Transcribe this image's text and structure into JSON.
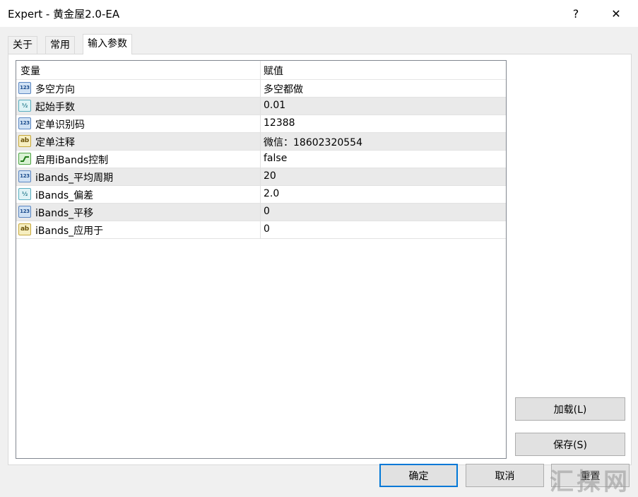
{
  "window": {
    "title": "Expert - 黄金屋2.0-EA",
    "help_glyph": "?",
    "close_glyph": "✕"
  },
  "tabs": [
    {
      "label": "关于"
    },
    {
      "label": "常用"
    },
    {
      "label": "输入参数",
      "active": true
    }
  ],
  "grid": {
    "headers": {
      "variable": "变量",
      "value": "赋值"
    },
    "rows": [
      {
        "icon": "int-icon",
        "type_glyph": "123",
        "name": "多空方向",
        "value": "多空都做"
      },
      {
        "icon": "double-icon",
        "type_glyph": "½",
        "name": "起始手数",
        "value": "0.01"
      },
      {
        "icon": "int-icon",
        "type_glyph": "123",
        "name": "定单识别码",
        "value": "12388"
      },
      {
        "icon": "string-icon",
        "type_glyph": "ab",
        "name": "定单注释",
        "value": "微信：18602320554"
      },
      {
        "icon": "bool-icon",
        "type_glyph": "",
        "name": "启用iBands控制",
        "value": "false"
      },
      {
        "icon": "int-icon",
        "type_glyph": "123",
        "name": "iBands_平均周期",
        "value": "20"
      },
      {
        "icon": "double-icon",
        "type_glyph": "½",
        "name": "iBands_偏差",
        "value": "2.0"
      },
      {
        "icon": "int-icon",
        "type_glyph": "123",
        "name": "iBands_平移",
        "value": "0"
      },
      {
        "icon": "string-icon",
        "type_glyph": "ab",
        "name": "iBands_应用于",
        "value": "0"
      }
    ]
  },
  "side_buttons": {
    "load": "加载(L)",
    "save": "保存(S)"
  },
  "bottom_buttons": {
    "ok": "确定",
    "cancel": "取消",
    "reset": "重置"
  },
  "watermark": "汇探网",
  "colors": {
    "accent": "#0078d7",
    "alt_row": "#eaeaea"
  }
}
